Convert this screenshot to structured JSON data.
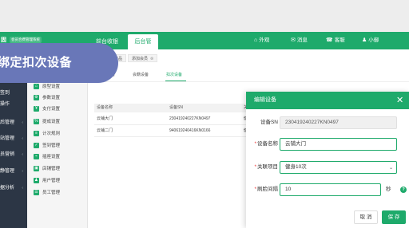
{
  "brand": {
    "logo": "固",
    "title": "会员合费管理系统"
  },
  "top_tabs": [
    "前台收银",
    "后台管理"
  ],
  "top_right": [
    {
      "icon": "shop-icon",
      "glyph": "⌂",
      "label": "外观"
    },
    {
      "icon": "message-icon",
      "glyph": "✉",
      "label": "消息"
    },
    {
      "icon": "service-icon",
      "glyph": "☎",
      "label": "客服"
    },
    {
      "icon": "user-icon",
      "glyph": "♟",
      "label": "小御"
    }
  ],
  "sidebar": [
    {
      "label": "签到",
      "chev": ""
    },
    {
      "label": "操作",
      "chev": ""
    },
    {
      "label": "后管理",
      "chev": "‹"
    },
    {
      "label": "站管理",
      "chev": "‹"
    },
    {
      "label": "员营销",
      "chev": "‹"
    },
    {
      "label": "静管理",
      "chev": "‹"
    },
    {
      "label": "据分析",
      "chev": "‹"
    }
  ],
  "subsidebar": [
    {
      "label": "原型设置",
      "icon": "shop-icon",
      "glyph": "⌂"
    },
    {
      "label": "参数设置",
      "icon": "settings-icon",
      "glyph": "⚙"
    },
    {
      "label": "支付设置",
      "icon": "pay-icon",
      "glyph": "¥"
    },
    {
      "label": "提成设置",
      "icon": "commission-icon",
      "glyph": "%"
    },
    {
      "label": "计次规则",
      "icon": "rule-icon",
      "glyph": "≡"
    },
    {
      "label": "签到管理",
      "icon": "checkin-icon",
      "glyph": "✓"
    },
    {
      "label": "插座设置",
      "icon": "plug-icon",
      "glyph": "⌁"
    },
    {
      "label": "店铺管理",
      "icon": "store-icon",
      "glyph": "▣"
    },
    {
      "label": "用户管理",
      "icon": "users-icon",
      "glyph": "♟"
    },
    {
      "label": "员工管理",
      "icon": "staff-icon",
      "glyph": "☰"
    }
  ],
  "page_tabs": [
    {
      "label": "商品"
    },
    {
      "label": "添加会员"
    }
  ],
  "sub_tabs": [
    "设备",
    "会籍设备",
    "扣次设备"
  ],
  "table": {
    "headers": [
      "设备名称",
      "设备SN",
      "关"
    ],
    "rows": [
      [
        "云铺大门",
        "230419240227KN0497",
        "健"
      ],
      [
        "云铺二门",
        "940619240416KN0166",
        "健"
      ]
    ]
  },
  "banner": "绑定扣次设备",
  "modal": {
    "title": "编辑设备",
    "close": "✕",
    "fields": {
      "sn": {
        "label": "设备SN",
        "value": "230419240227KN0497"
      },
      "name": {
        "label": "设备名称",
        "value": "云铺大门"
      },
      "project": {
        "label": "关联项目",
        "value": "健身10次"
      },
      "interval": {
        "label": "刷脸间隔",
        "value": "10",
        "unit": "秒"
      }
    },
    "cancel": "取 消",
    "save": "保 存"
  },
  "colors": {
    "accent": "#1eaa6b",
    "banner": "#6977b8",
    "sidebar": "#2c3645"
  }
}
